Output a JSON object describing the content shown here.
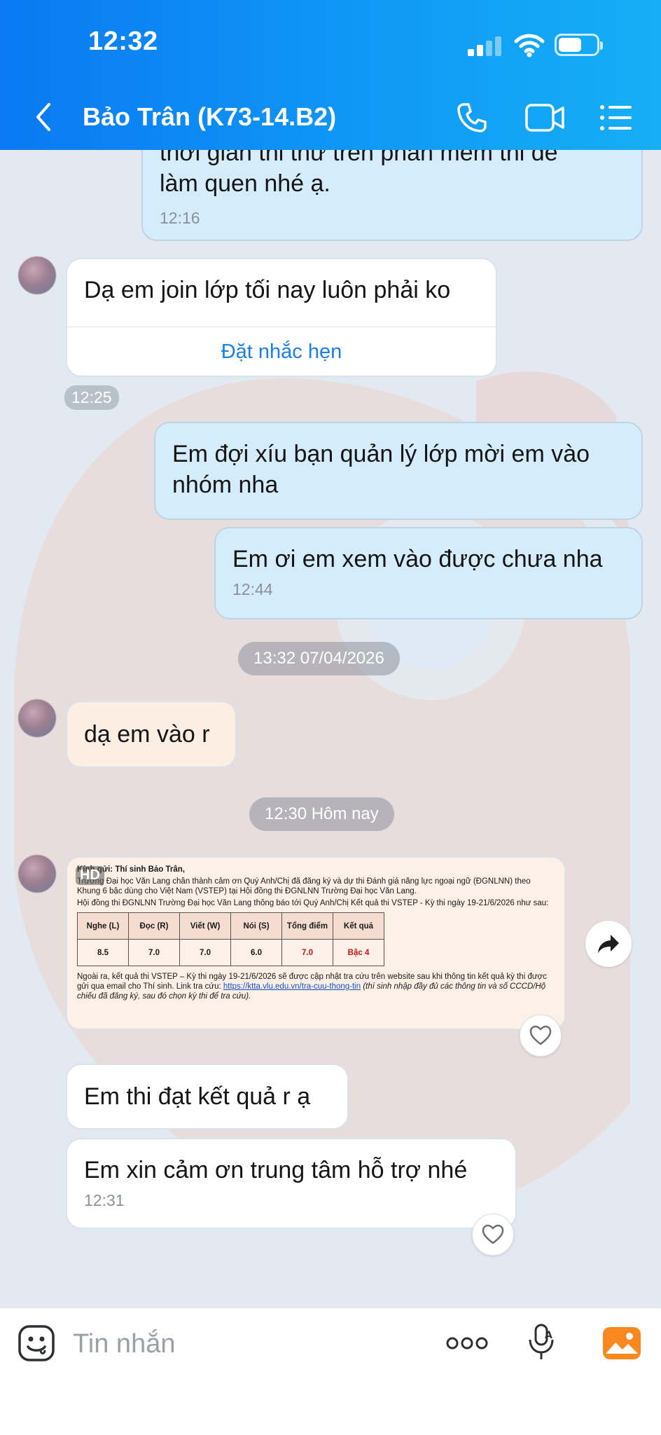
{
  "status_bar": {
    "time": "12:32"
  },
  "header": {
    "title": "Bảo Trân (K73-14.B2)"
  },
  "messages": {
    "m1_text_line1": "thời gian thi thử trên phần mềm thi để",
    "m1_text_line2": "làm quen nhé ạ.",
    "m1_time": "12:16",
    "m2_text": "Dạ em join lớp tối nay luôn phải ko",
    "m2_remind": "Đặt nhắc hẹn",
    "m2_time": "12:25",
    "m3_text": "Em đợi xíu bạn quản lý lớp mời em vào nhóm nha",
    "m4_text": "Em ơi em xem vào được chưa nha",
    "m4_time": "12:44",
    "date1": "13:32 07/04/2026",
    "m5_text": "dạ em vào r",
    "date2": "12:30 Hôm nay",
    "m7_text": "Em thi đạt kết quả r ạ",
    "m8_text": "Em xin cảm ơn trung tâm hỗ trợ nhé",
    "m8_time": "12:31"
  },
  "result_image": {
    "hd_badge": "HD",
    "line_greeting": "Kính gửi: Thí sinh Bảo Trân,",
    "line_intro": "Trường Đại học Văn Lang chân thành cảm ơn Quý Anh/Chị đã đăng ký và dự thi Đánh giá năng lực ngoại ngữ (ĐGNLNN) theo Khung 6 bậc dùng cho Việt Nam (VSTEP) tại Hội đồng thi ĐGNLNN Trường Đại học Văn Lang.",
    "line_notice": "Hội đồng thi ĐGNLNN Trường Đại học Văn Lang thông báo tới Quý Anh/Chị Kết quả thi VSTEP - Kỳ thi ngày 19-21/6/2026 như sau:",
    "headers": [
      "Nghe (L)",
      "Đọc (R)",
      "Viết (W)",
      "Nói (S)",
      "Tổng điểm",
      "Kết quả"
    ],
    "scores": [
      "8.5",
      "7.0",
      "7.0",
      "6.0",
      "7.0",
      "Bậc 4"
    ],
    "line_footer": "Ngoài ra, kết quả thi VSTEP – Kỳ thi ngày 19-21/6/2026 sẽ được cập nhật tra cứu trên website sau khi thông tin kết quả kỳ thi được gửi qua email cho Thí sinh. Link tra cứu:",
    "link": "https://ktta.vlu.edu.vn/tra-cuu-thong-tin",
    "line_footer_tail": "(thí sinh nhập đầy đủ các thông tin và số CCCD/Hộ chiếu đã đăng ký, sau đó chọn kỳ thi để tra cứu)."
  },
  "input": {
    "placeholder": "Tin nhắn"
  },
  "icons": {
    "back": "chevron-left-icon",
    "call": "phone-icon",
    "video": "video-camera-icon",
    "menu": "list-menu-icon",
    "share": "share-forward-icon",
    "heart": "heart-icon",
    "sticker": "sticker-icon",
    "more": "more-dots-icon",
    "voice": "microphone-icon",
    "image": "image-gallery-icon"
  },
  "colors": {
    "header": "#0a79f2",
    "outgoing": "#d4ecfb",
    "incoming": "#ffffff",
    "accent": "#1a7fe8",
    "gallery": "#f9891f"
  }
}
